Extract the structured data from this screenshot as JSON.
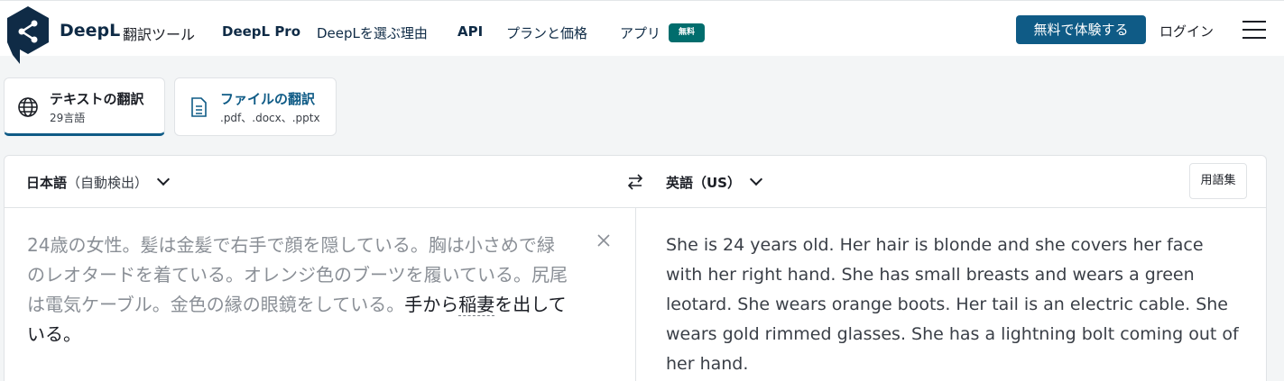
{
  "header": {
    "brand": "DeepL",
    "brand_sub": "翻訳ツール",
    "nav": [
      {
        "label": "DeepL Pro"
      },
      {
        "label": "DeepLを選ぶ理由"
      },
      {
        "label": "API"
      },
      {
        "label": "プランと価格"
      },
      {
        "label": "アプリ"
      }
    ],
    "app_badge": "無料",
    "cta_label": "無料で体験する",
    "login_label": "ログイン",
    "brand_color": "#0f2b46",
    "accent_color": "#0f5b86",
    "badge_color": "#006d6d",
    "logo_icon": "deepl-share-icon",
    "menu_icon": "hamburger-icon"
  },
  "modes": {
    "text": {
      "title": "テキストの翻訳",
      "subtitle": "29言語",
      "icon": "globe-icon"
    },
    "file": {
      "title": "ファイルの翻訳",
      "subtitle": ".pdf、.docx、.pptx",
      "icon": "document-icon"
    }
  },
  "translator": {
    "source_lang": "日本語",
    "source_note": "（自動検出）",
    "target_lang": "英語（US）",
    "glossary_label": "用語集",
    "swap_icon": "swap-arrows-icon",
    "clear_icon": "close-icon",
    "source_text_1": "24歳の女性。髪は金髪で右手で顔を隠している。胸は小さめで緑のレオタードを着ている。オレンジ色のブーツを履いている。尻尾は電気ケーブル。金色の縁の眼鏡をしている。",
    "source_text_2": "手から",
    "source_text_3": "稲妻",
    "source_text_4": "を出している。",
    "target_text": "She is 24 years old. Her hair is blonde and she covers her face with her right hand. She has small breasts and wears a green leotard. She wears orange boots. Her tail is an electric cable. She wears gold rimmed glasses. She has a lightning bolt coming out of her hand."
  }
}
